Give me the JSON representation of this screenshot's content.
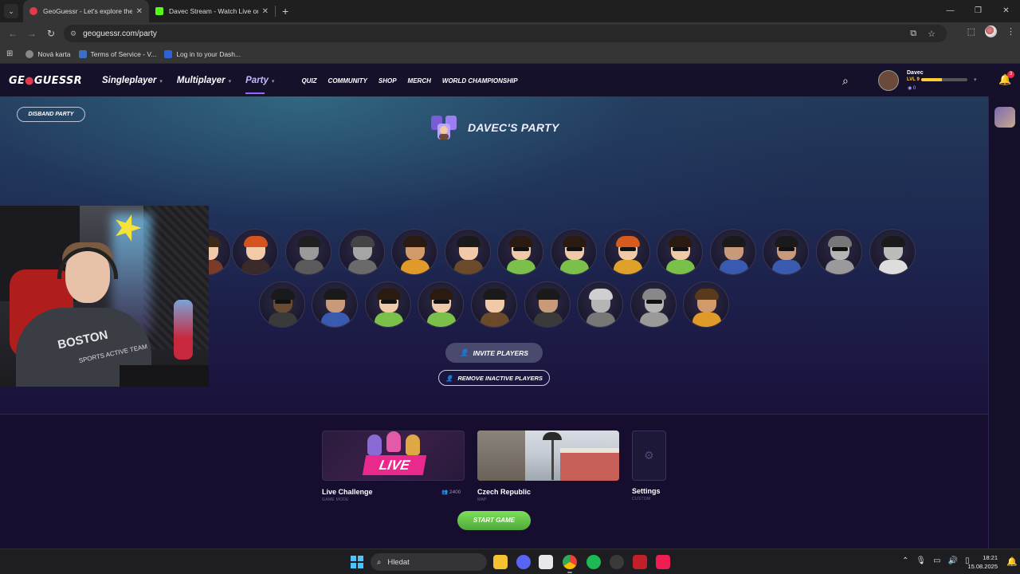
{
  "browser": {
    "tabs": [
      {
        "title": "GeoGuessr - Let's explore the w",
        "active": true,
        "favicon_color": "#e23a4a"
      },
      {
        "title": "Davec Stream - Watch Live on K",
        "active": false,
        "favicon_color": "#53fc18"
      }
    ],
    "new_tab_label": "+",
    "url": "geoguessr.com/party",
    "bookmarks": [
      {
        "label": "Nová karta",
        "icon": "globe-icon"
      },
      {
        "label": "Terms of Service - V...",
        "icon": "v-icon"
      },
      {
        "label": "Log in to your Dash...",
        "icon": "a-icon"
      }
    ]
  },
  "header": {
    "logo_text_1": "GE",
    "logo_pin": "●",
    "logo_text_2": "GUESSR",
    "nav": [
      {
        "label": "Singleplayer",
        "active": false
      },
      {
        "label": "Multiplayer",
        "active": false
      },
      {
        "label": "Party",
        "active": true
      }
    ],
    "subnav": [
      "QUIZ",
      "COMMUNITY",
      "SHOP",
      "MERCH",
      "WORLD CHAMPIONSHIP"
    ],
    "user": {
      "name": "Davec",
      "level": "LVL 9",
      "xp_fraction": 0.45,
      "coins": "0"
    },
    "notification_count": "3"
  },
  "party": {
    "disband_label": "DISBAND PARTY",
    "title": "DAVEC'S PARTY",
    "invite_label": "INVITE PLAYERS",
    "remove_label": "REMOVE INACTIVE PLAYERS"
  },
  "game": {
    "cards": [
      {
        "name": "Live Challenge",
        "sub": "GAME MODE",
        "count": "2400",
        "badge": "LIVE"
      },
      {
        "name": "Czech Republic",
        "sub": "MAP"
      },
      {
        "name": "Settings",
        "sub": "CUSTOM"
      }
    ],
    "start_label": "START GAME"
  },
  "webcam": {
    "shirt_text": "BOSTON",
    "shirt_sub": "SPORTS ACTIVE TEAM"
  },
  "taskbar": {
    "search_label": "Hledat",
    "time": "18:21",
    "date": "15.08.2025"
  }
}
